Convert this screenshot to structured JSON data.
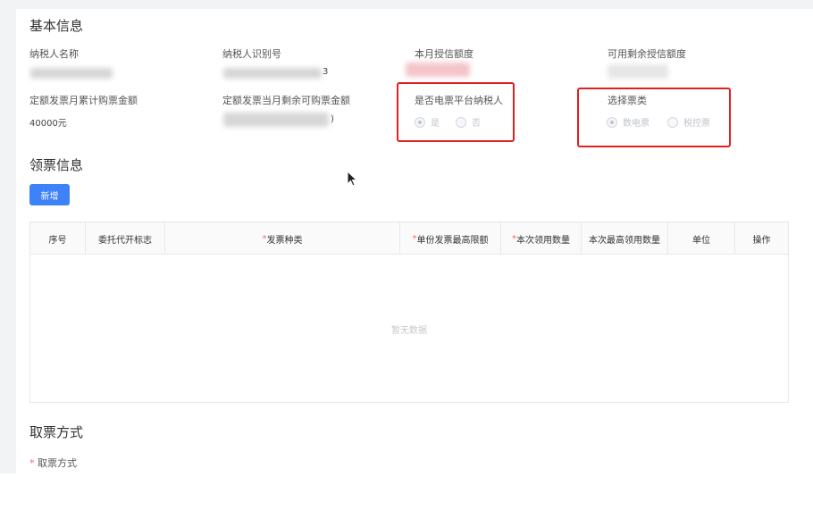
{
  "basic_info": {
    "title": "基本信息",
    "fields": {
      "taxpayer_name": {
        "label": "纳税人名称"
      },
      "taxpayer_id": {
        "label": "纳税人识别号",
        "value_tail": "3"
      },
      "monthly_credit": {
        "label": "本月授信额度"
      },
      "remaining_credit": {
        "label": "可用剩余授信额度"
      },
      "monthly_purchase": {
        "label": "定额发票月累计购票金额",
        "value": "40000元"
      },
      "monthly_remaining": {
        "label": "定额发票当月剩余可购票金额",
        "value_tail": ")"
      }
    },
    "platform_taxpayer": {
      "label": "是否电票平台纳税人",
      "options": [
        "是",
        "否"
      ],
      "selected": "是"
    },
    "ticket_type": {
      "label": "选择票类",
      "options": [
        "数电票",
        "税控票"
      ],
      "selected": "数电票"
    }
  },
  "ticket_info": {
    "title": "领票信息",
    "add_button": "新增",
    "table": {
      "columns": [
        {
          "label": "序号",
          "required": false
        },
        {
          "label": "委托代开标志",
          "required": false
        },
        {
          "label": "发票种类",
          "required": true
        },
        {
          "label": "单份发票最高限额",
          "required": true
        },
        {
          "label": "本次领用数量",
          "required": true
        },
        {
          "label": "本次最高领用数量",
          "required": false
        },
        {
          "label": "单位",
          "required": false
        },
        {
          "label": "操作",
          "required": false
        }
      ],
      "empty_text": "暂无数据"
    }
  },
  "pickup": {
    "title": "取票方式",
    "method_label": "取票方式",
    "required_mark": "*"
  },
  "colors": {
    "primary": "#3d82f6",
    "highlight_box": "#e02020",
    "required": "#f56c6c"
  }
}
